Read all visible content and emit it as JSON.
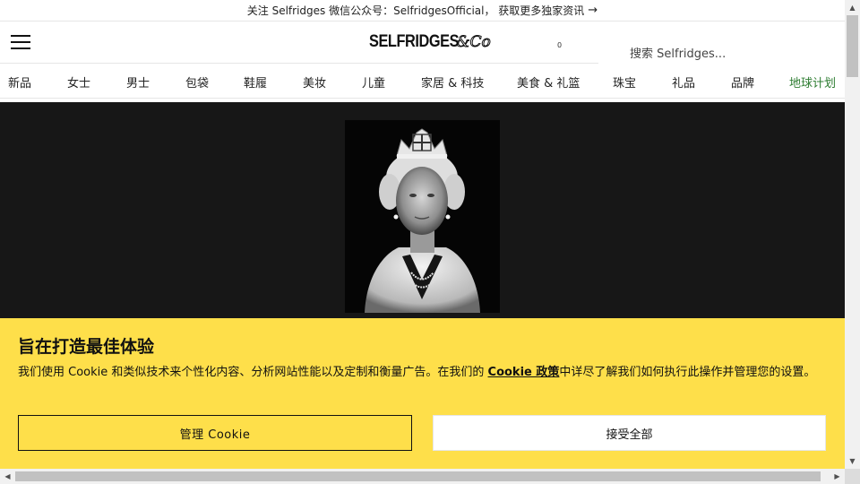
{
  "promo": {
    "text": "关注 Selfridges 微信公众号：SelfridgesOfficial， 获取更多独家资讯",
    "arrow": "→"
  },
  "header": {
    "logo_text": "SELFRIDGES",
    "logo_suffix": "&Co",
    "bag_count": "0",
    "search_placeholder": "搜索 Selfridges..."
  },
  "nav": {
    "items": [
      {
        "label": "新品"
      },
      {
        "label": "女士"
      },
      {
        "label": "男士"
      },
      {
        "label": "包袋"
      },
      {
        "label": "鞋履"
      },
      {
        "label": "美妆"
      },
      {
        "label": "儿童"
      },
      {
        "label": "家居 & 科技"
      },
      {
        "label": "美食 & 礼篮"
      },
      {
        "label": "珠宝"
      },
      {
        "label": "礼品"
      },
      {
        "label": "品牌"
      },
      {
        "label": "地球计划"
      }
    ]
  },
  "cookie": {
    "title": "旨在打造最佳体验",
    "text_before": "我们使用 Cookie 和类似技术来个性化内容、分析网站性能以及定制和衡量广告。在我们的 ",
    "link": "Cookie 政策",
    "text_after": "中详尽了解我们如何执行此操作并管理您的设置。",
    "manage_label": "管理 Cookie",
    "accept_label": "接受全部"
  },
  "colors": {
    "banner_bg": "#fedf4a",
    "hero_bg": "#171717",
    "planet_green": "#2e7d32"
  }
}
